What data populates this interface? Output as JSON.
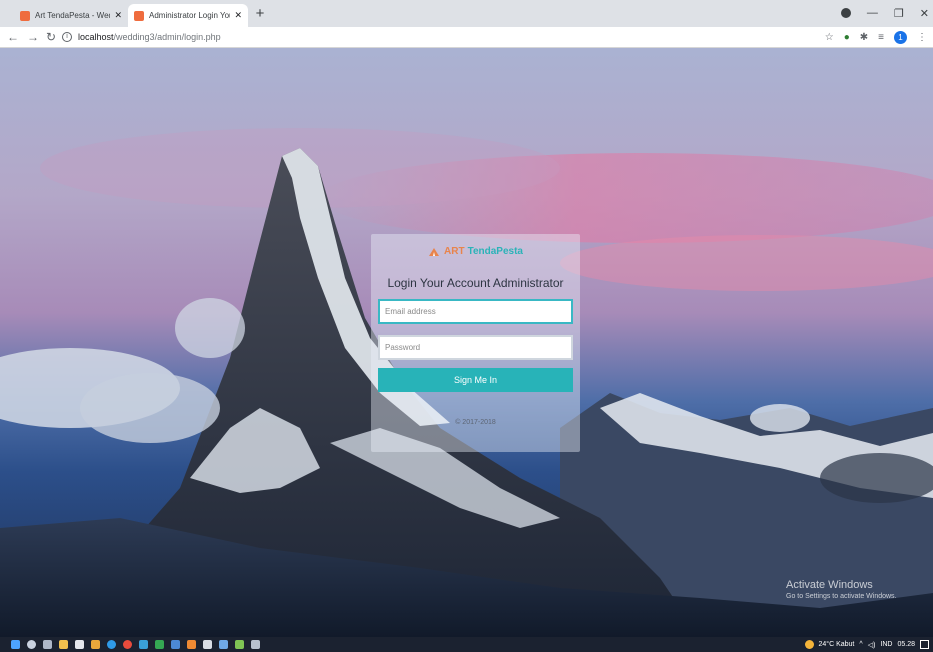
{
  "browser": {
    "tabs": [
      {
        "title": "Art TendaPesta - Wedding Planne",
        "active": false
      },
      {
        "title": "Administrator Login Your Accoun",
        "active": true
      }
    ],
    "url_host": "localhost",
    "url_path": "/wedding3/admin/login.php"
  },
  "icons": {
    "back": "arrow-left-icon",
    "forward": "arrow-right-icon",
    "reload": "reload-icon",
    "info": "info-icon",
    "star": "star-icon",
    "extensions": "puzzle-icon",
    "account": "account-icon"
  },
  "account_initial": "1",
  "login": {
    "brand_art": "ART",
    "brand_name": "TendaPesta",
    "heading": "Login Your Account Administrator",
    "email_placeholder": "Email address",
    "password_placeholder": "Password",
    "submit_label": "Sign Me In",
    "copyright": "© 2017-2018"
  },
  "watermark": {
    "title": "Activate Windows",
    "subtitle": "Go to Settings to activate Windows."
  },
  "taskbar": {
    "weather": "24°C Kabut",
    "language": "IND",
    "time": "05.28"
  },
  "colors": {
    "accent": "#28b3b8",
    "brand_art": "#e8844c",
    "taskbar": "#1b2230"
  }
}
